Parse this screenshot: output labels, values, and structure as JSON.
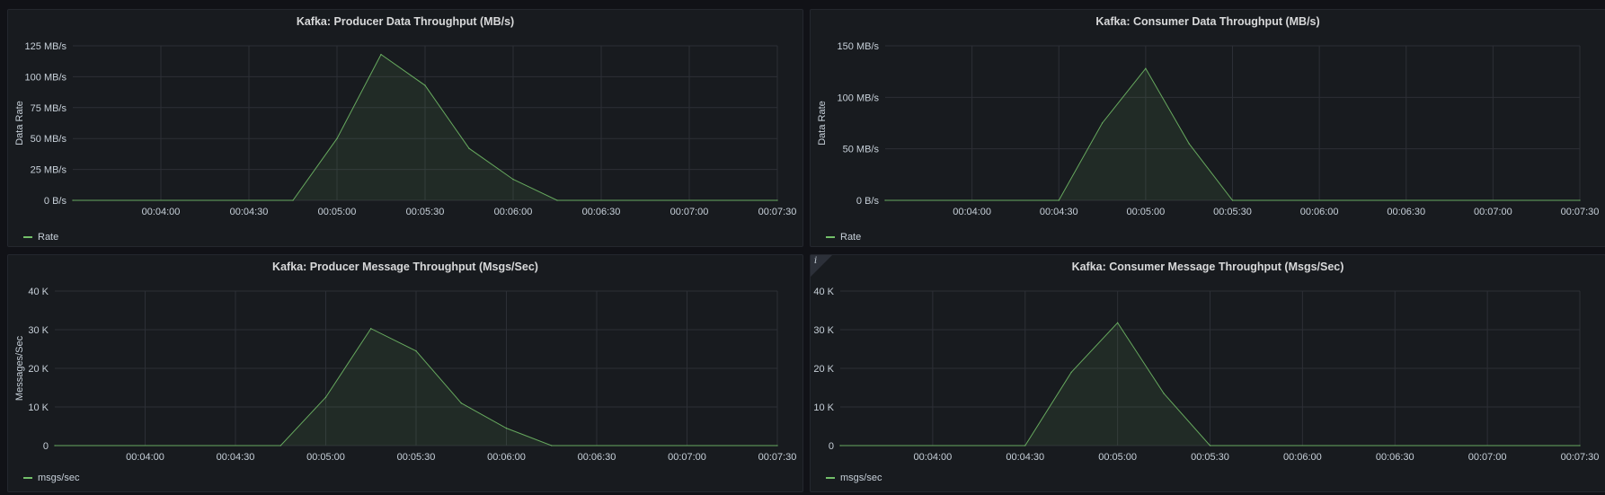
{
  "colors": {
    "background": "#111217",
    "panel": "#181b1f",
    "grid": "#2c2f36",
    "series": "#73bf69"
  },
  "chart_data": [
    {
      "type": "area",
      "title": "Kafka: Producer Data Throughput (MB/s)",
      "xlabel": "",
      "ylabel": "Data Rate",
      "x_ticks": [
        "00:04:00",
        "00:04:30",
        "00:05:00",
        "00:05:30",
        "00:06:00",
        "00:06:30",
        "00:07:00",
        "00:07:30"
      ],
      "y_ticks": [
        "0 B/s",
        "25 MB/s",
        "50 MB/s",
        "75 MB/s",
        "100 MB/s",
        "125 MB/s"
      ],
      "ylim": [
        0,
        125
      ],
      "xlim": [
        "00:03:30",
        "00:07:30"
      ],
      "grid": true,
      "legend_placement": "bottom-left",
      "series": [
        {
          "name": "Rate",
          "x": [
            "00:03:30",
            "00:04:45",
            "00:05:00",
            "00:05:15",
            "00:05:30",
            "00:05:45",
            "00:06:00",
            "00:06:15",
            "00:07:30"
          ],
          "values": [
            0,
            0,
            50,
            118,
            93,
            42,
            17,
            0,
            0
          ]
        }
      ]
    },
    {
      "type": "area",
      "title": "Kafka: Consumer Data Throughput (MB/s)",
      "xlabel": "",
      "ylabel": "Data Rate",
      "x_ticks": [
        "00:04:00",
        "00:04:30",
        "00:05:00",
        "00:05:30",
        "00:06:00",
        "00:06:30",
        "00:07:00",
        "00:07:30"
      ],
      "y_ticks": [
        "0 B/s",
        "50 MB/s",
        "100 MB/s",
        "150 MB/s"
      ],
      "ylim": [
        0,
        150
      ],
      "xlim": [
        "00:03:30",
        "00:07:30"
      ],
      "grid": true,
      "legend_placement": "bottom-left",
      "series": [
        {
          "name": "Rate",
          "x": [
            "00:03:30",
            "00:04:30",
            "00:04:45",
            "00:05:00",
            "00:05:15",
            "00:05:30",
            "00:07:30"
          ],
          "values": [
            0,
            0,
            75,
            128,
            55,
            0,
            0
          ]
        }
      ]
    },
    {
      "type": "area",
      "title": "Kafka: Producer Message Throughput (Msgs/Sec)",
      "xlabel": "",
      "ylabel": "Messages/Sec",
      "x_ticks": [
        "00:04:00",
        "00:04:30",
        "00:05:00",
        "00:05:30",
        "00:06:00",
        "00:06:30",
        "00:07:00",
        "00:07:30"
      ],
      "y_ticks": [
        "0",
        "10 K",
        "20 K",
        "30 K",
        "40 K"
      ],
      "ylim": [
        0,
        40000
      ],
      "xlim": [
        "00:03:30",
        "00:07:30"
      ],
      "grid": true,
      "legend_placement": "bottom-left",
      "series": [
        {
          "name": "msgs/sec",
          "x": [
            "00:03:30",
            "00:04:45",
            "00:05:00",
            "00:05:15",
            "00:05:30",
            "00:05:45",
            "00:06:00",
            "00:06:15",
            "00:07:30"
          ],
          "values": [
            0,
            0,
            12500,
            30300,
            24500,
            11000,
            4500,
            0,
            0
          ]
        }
      ]
    },
    {
      "type": "area",
      "title": "Kafka: Consumer Message Throughput (Msgs/Sec)",
      "xlabel": "",
      "ylabel": "",
      "x_ticks": [
        "00:04:00",
        "00:04:30",
        "00:05:00",
        "00:05:30",
        "00:06:00",
        "00:06:30",
        "00:07:00",
        "00:07:30"
      ],
      "y_ticks": [
        "0",
        "10 K",
        "20 K",
        "30 K",
        "40 K"
      ],
      "ylim": [
        0,
        40000
      ],
      "xlim": [
        "00:03:30",
        "00:07:30"
      ],
      "grid": true,
      "legend_placement": "bottom-left",
      "series": [
        {
          "name": "msgs/sec",
          "x": [
            "00:03:30",
            "00:04:30",
            "00:04:45",
            "00:05:00",
            "00:05:15",
            "00:05:30",
            "00:07:30"
          ],
          "values": [
            0,
            0,
            19000,
            31800,
            13500,
            0,
            0
          ]
        }
      ]
    }
  ]
}
